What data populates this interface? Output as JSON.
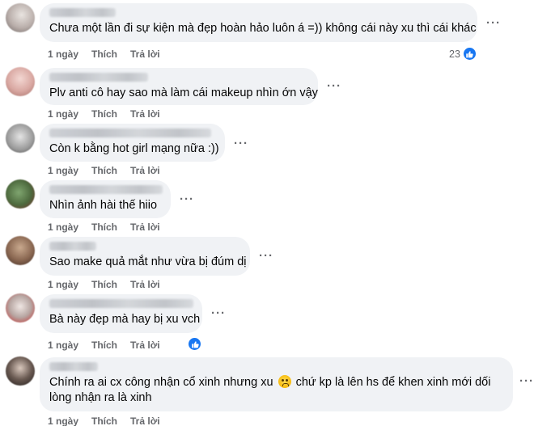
{
  "actions": {
    "like_label": "Thích",
    "reply_label": "Trả lời",
    "more_label": "···"
  },
  "comments": [
    {
      "time": "1 ngày",
      "text": "Chưa một lần đi sự kiện mà đẹp hoàn hảo luôn á =)) không cái này xu thì cái khác",
      "reactions": "23"
    },
    {
      "time": "1 ngày",
      "text": "Plv anti cô hay sao mà làm cái makeup nhìn ớn vậy"
    },
    {
      "time": "1 ngày",
      "text": "Còn k bằng hot girl mạng nữa :))"
    },
    {
      "time": "1 ngày",
      "text": "Nhìn ảnh hài thế hiio"
    },
    {
      "time": "1 ngày",
      "text": "Sao make quả mắt như vừa bị đúm dị"
    },
    {
      "time": "1 ngày",
      "text": "Bà này đẹp mà hay bị xu vch",
      "reactions": ""
    },
    {
      "time": "1 ngày",
      "text_part1": "Chính ra ai cx công nhận cổ xinh nhưng xu",
      "emoji": "crying-face",
      "text_part2": "chứ kp là lên hs để khen xinh mới dối lòng nhận ra là xinh"
    }
  ]
}
